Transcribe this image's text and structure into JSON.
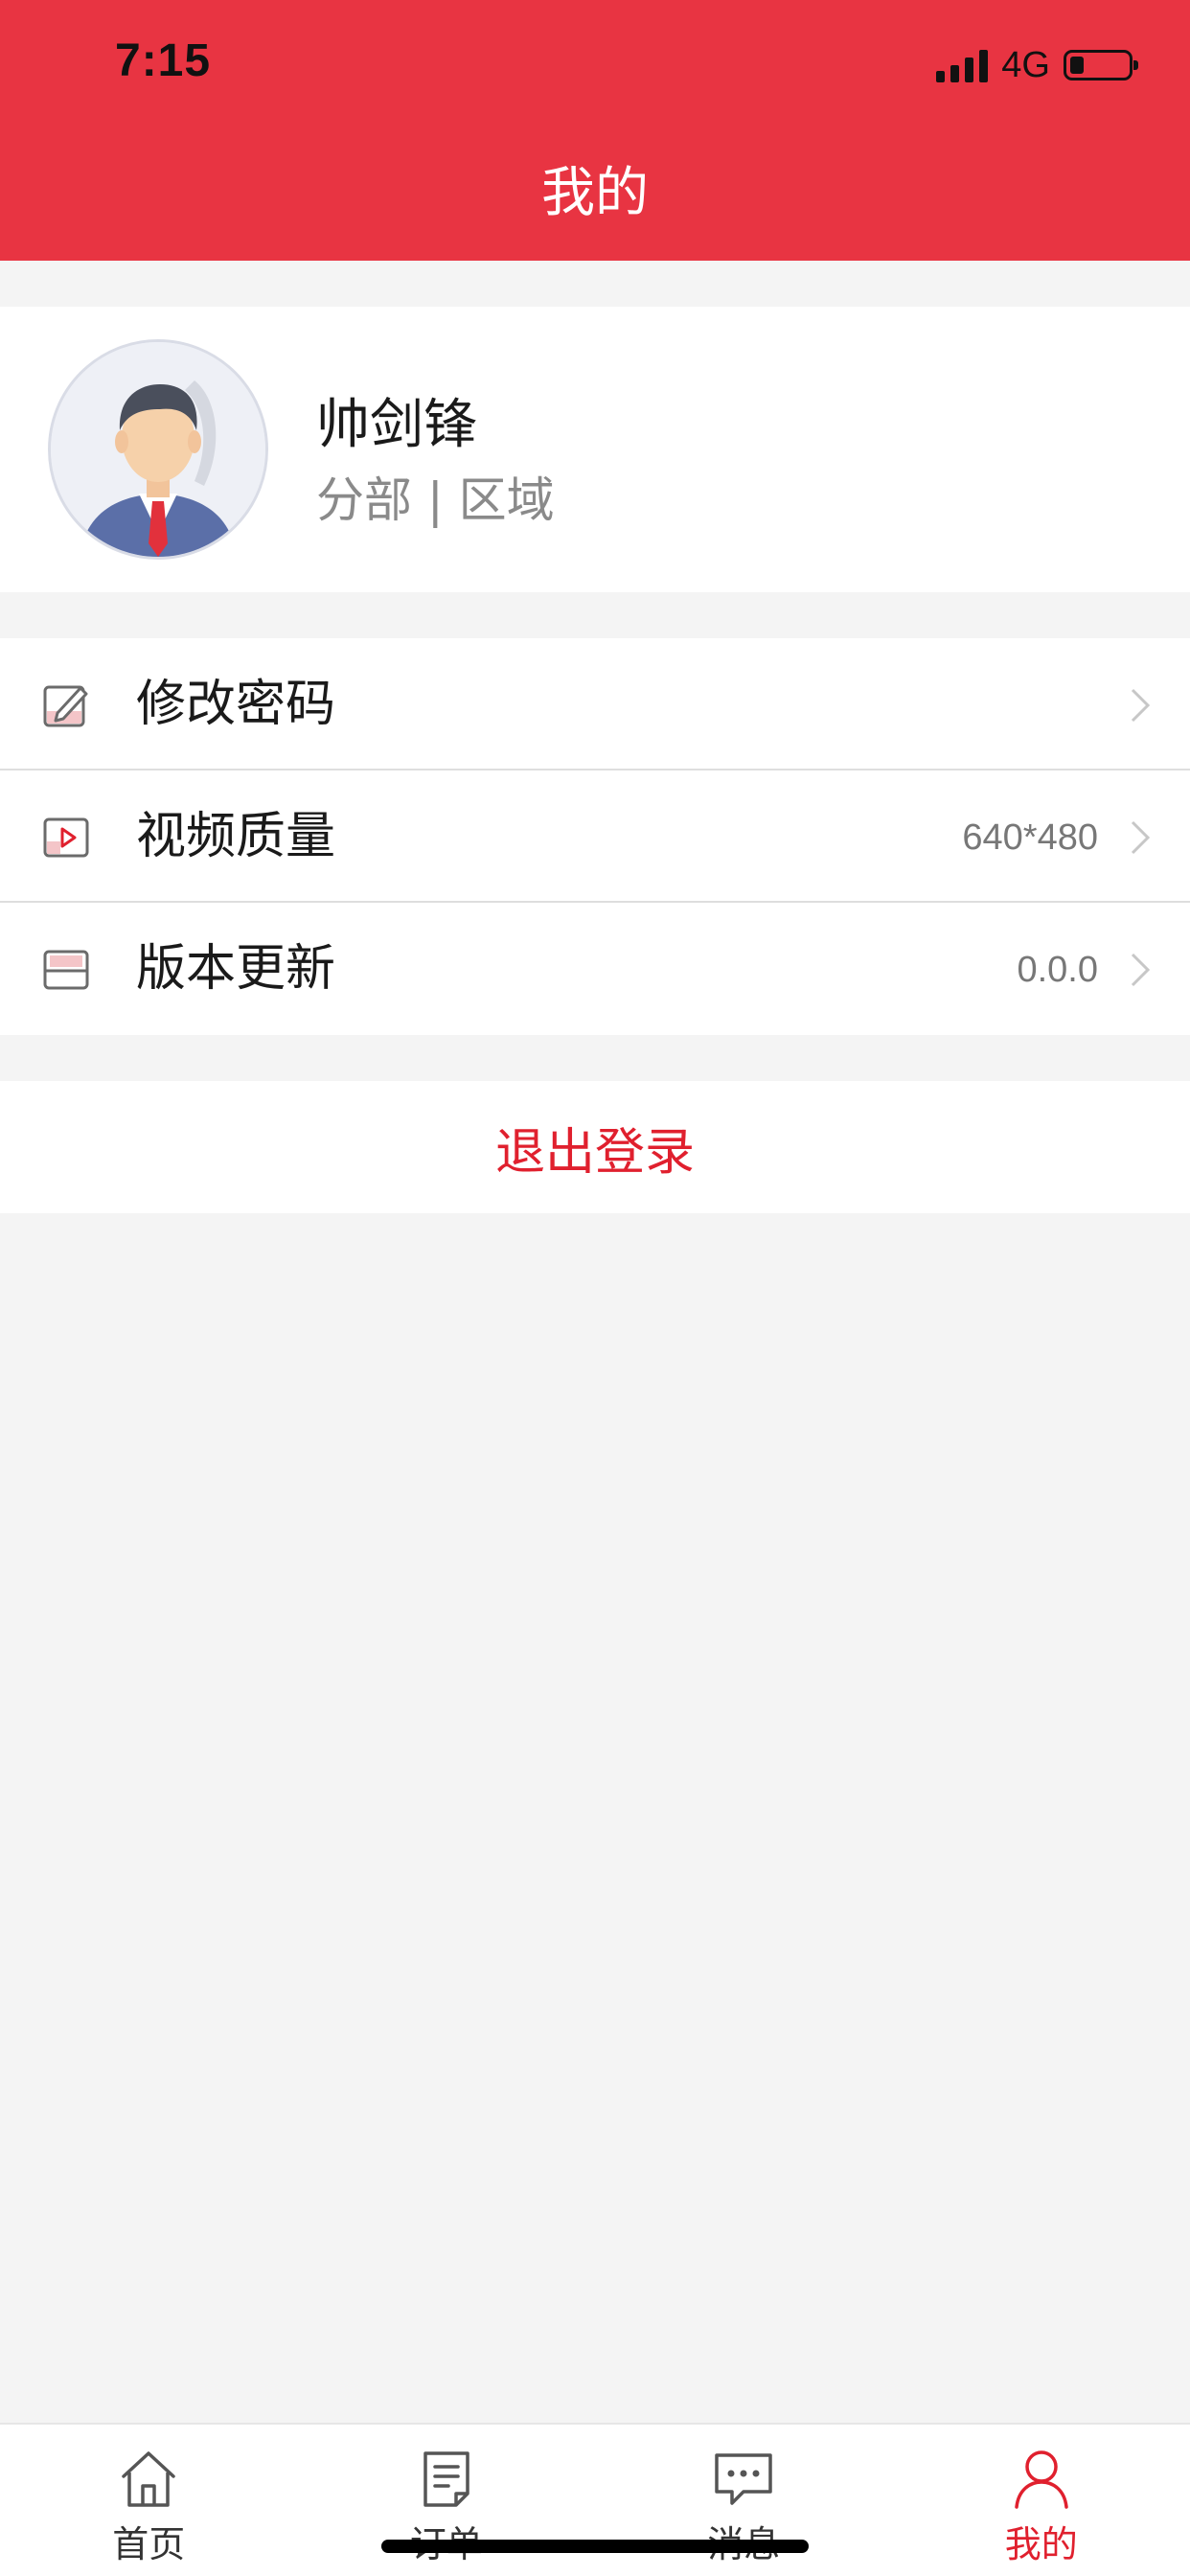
{
  "status_bar": {
    "time": "7:15",
    "network": "4G",
    "battery_level": 0.15,
    "signal_bars": 4
  },
  "header": {
    "title": "我的"
  },
  "profile": {
    "name": "帅剑锋",
    "subtitle": "分部 | 区域"
  },
  "settings": {
    "items": [
      {
        "label": "修改密码",
        "value": "",
        "icon": "edit-icon"
      },
      {
        "label": "视频质量",
        "value": "640*480",
        "icon": "video-icon"
      },
      {
        "label": "版本更新",
        "value": "0.0.0",
        "icon": "save-icon"
      }
    ]
  },
  "logout": {
    "label": "退出登录"
  },
  "tab_bar": {
    "active": "我的",
    "tabs": [
      {
        "label": "首页",
        "icon": "home-icon"
      },
      {
        "label": "订单",
        "icon": "order-icon"
      },
      {
        "label": "消息",
        "icon": "message-icon"
      },
      {
        "label": "我的",
        "icon": "user-icon"
      }
    ]
  },
  "colors": {
    "brand": "#e83442",
    "accent_text": "#e0202e",
    "background": "#f4f4f4"
  }
}
